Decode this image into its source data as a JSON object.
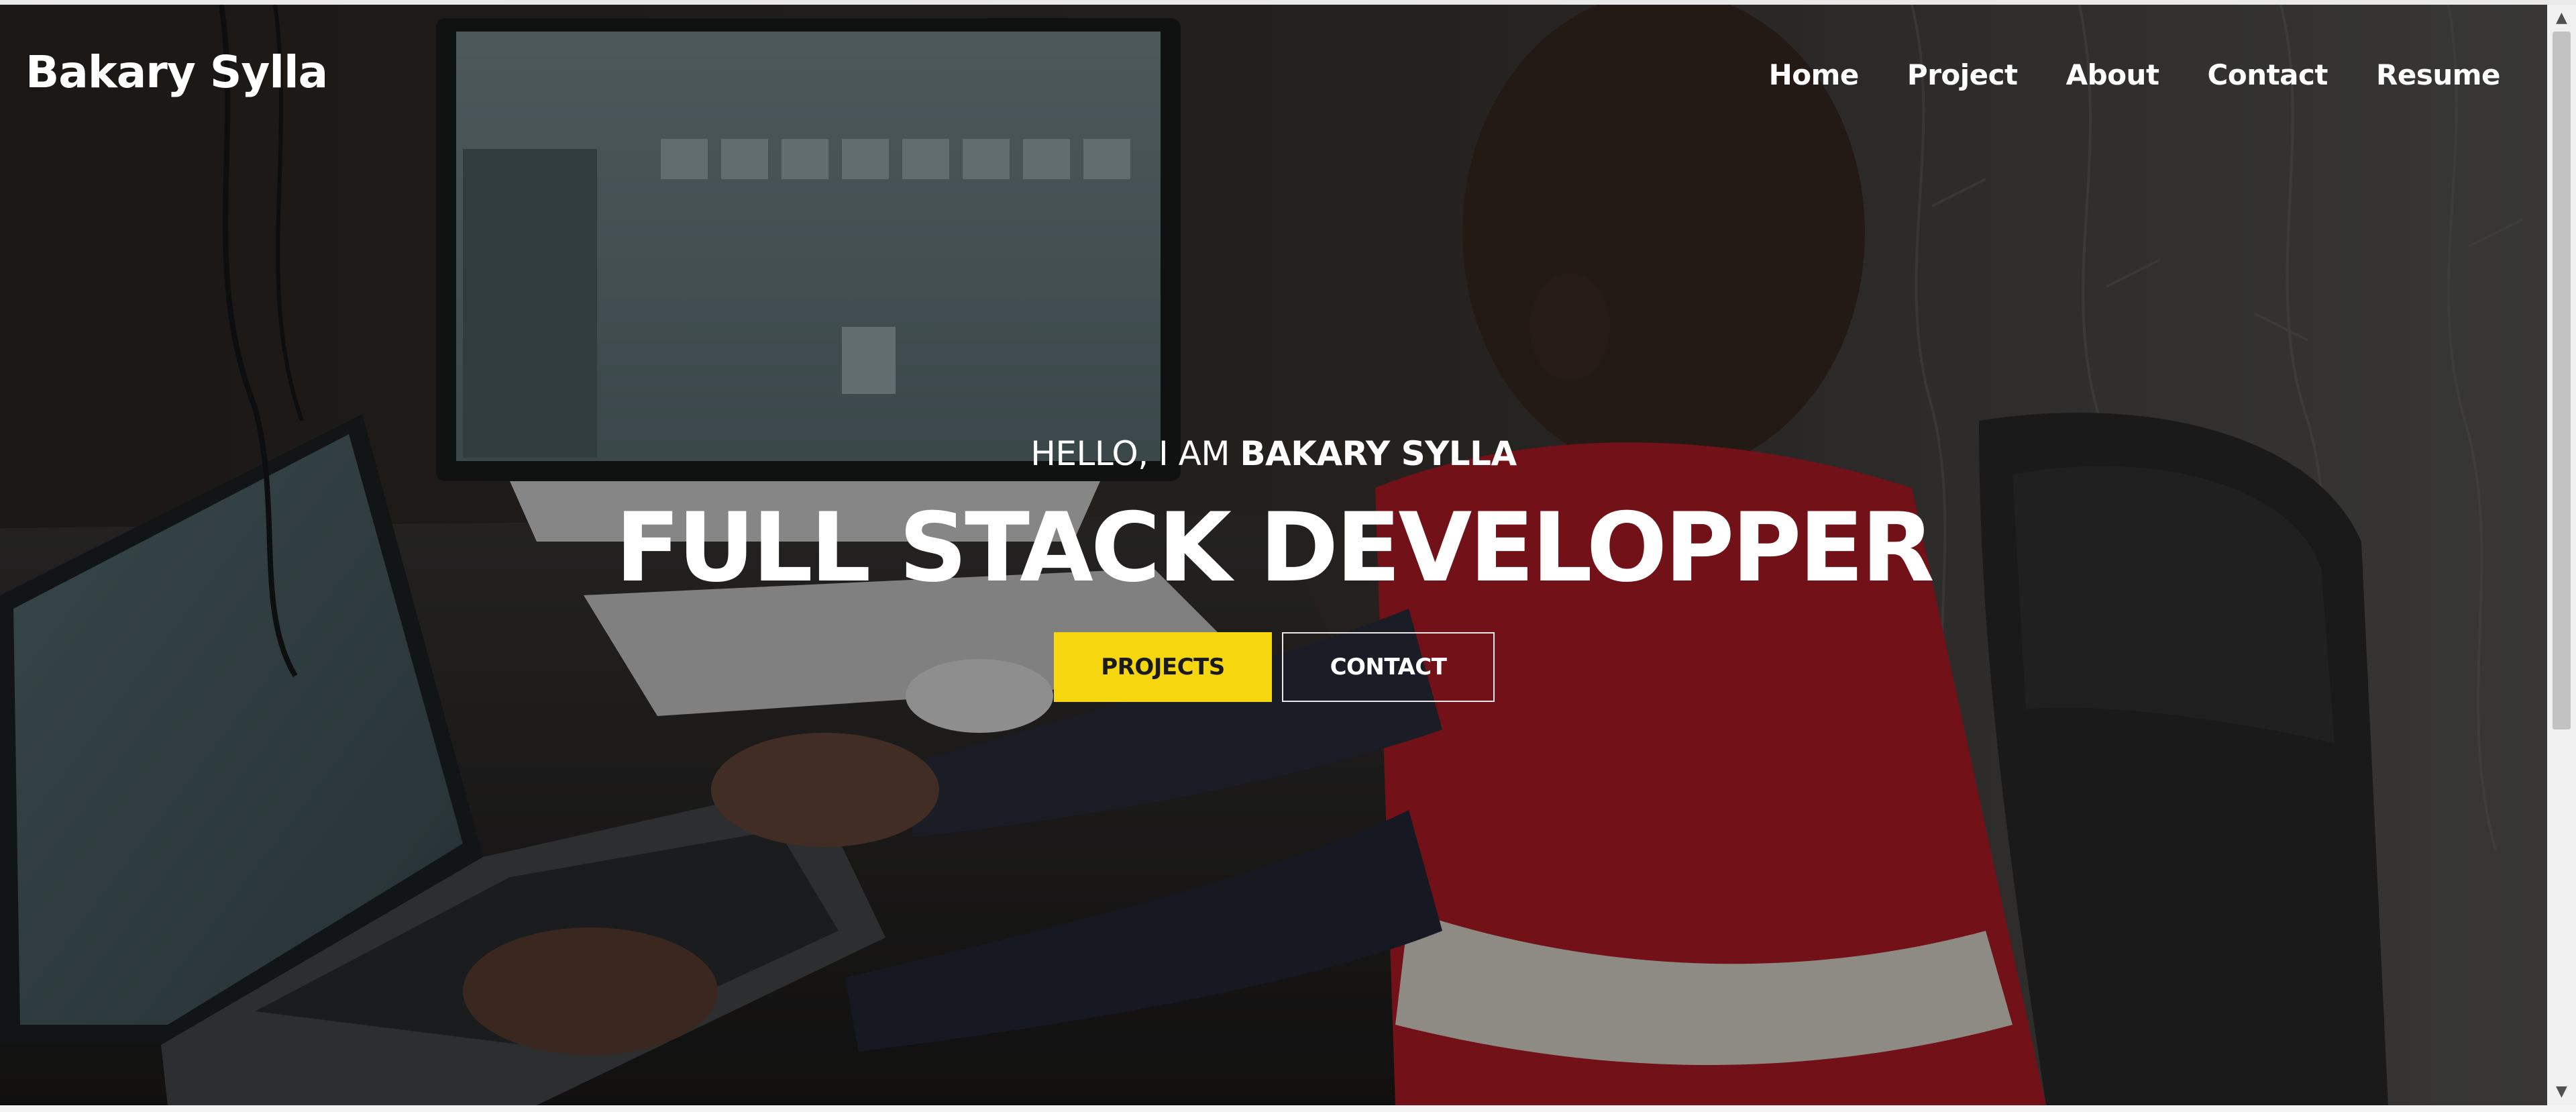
{
  "brand": {
    "name": "Bakary Sylla"
  },
  "nav": {
    "items": [
      {
        "label": "Home"
      },
      {
        "label": "Project"
      },
      {
        "label": "About"
      },
      {
        "label": "Contact"
      },
      {
        "label": "Resume"
      }
    ]
  },
  "hero": {
    "intro_prefix": "HELLO, I AM",
    "intro_name": "BAKARY SYLLA",
    "headline": "FULL STACK DEVELOPPER",
    "projects_button": "PROJECTS",
    "contact_button": "CONTACT"
  },
  "colors": {
    "accent": "#f5d60f",
    "text": "#ffffff",
    "overlay": "rgba(0,0,0,0.38)"
  },
  "icons": {
    "scroll_up": "triangle-up-icon",
    "scroll_down": "triangle-down-icon"
  }
}
